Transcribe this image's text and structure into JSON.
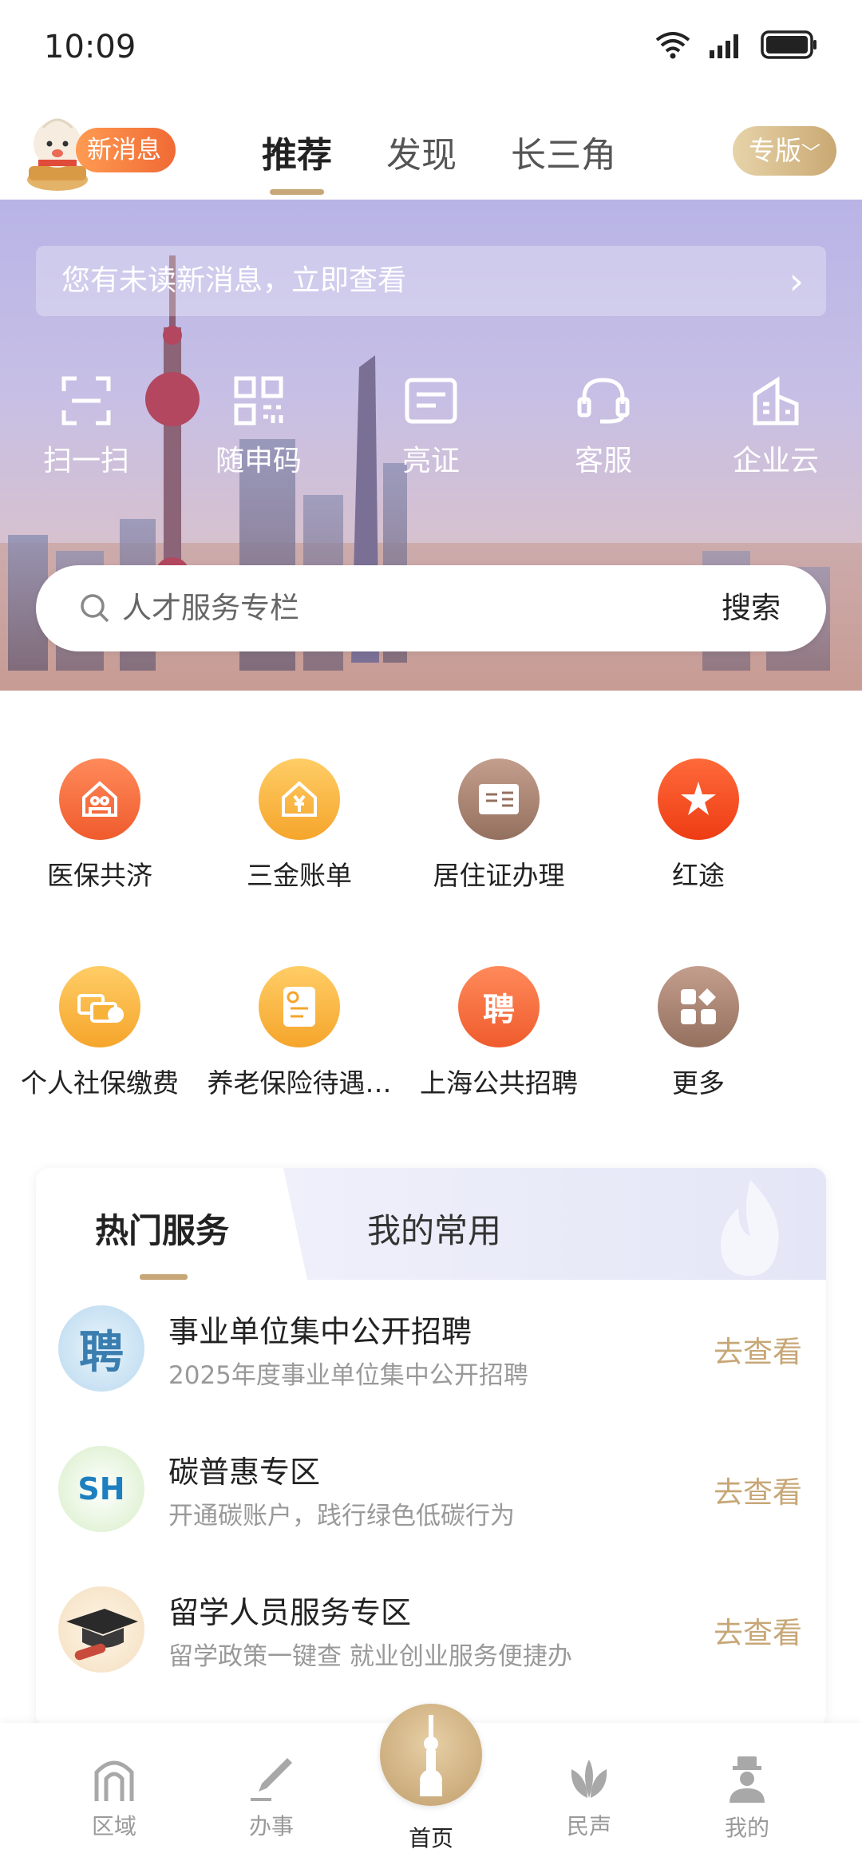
{
  "status": {
    "time": "10:09",
    "icons": [
      "wifi-icon",
      "signal-icon",
      "battery-icon"
    ]
  },
  "topnav": {
    "new_message": "新消息",
    "tabs": [
      {
        "label": "推荐",
        "active": true
      },
      {
        "label": "发现"
      },
      {
        "label": "长三角"
      }
    ],
    "edition": "专版"
  },
  "hero": {
    "unread_text": "您有未读新消息，立即查看",
    "quick_actions": [
      {
        "label": "扫一扫",
        "icon": "scan-icon"
      },
      {
        "label": "随申码",
        "icon": "qr-code-icon"
      },
      {
        "label": "亮证",
        "icon": "id-card-icon"
      },
      {
        "label": "客服",
        "icon": "headset-icon"
      },
      {
        "label": "企业云",
        "icon": "building-icon"
      }
    ],
    "search_placeholder": "人才服务专栏",
    "search_button": "搜索"
  },
  "services_grid": [
    {
      "label": "医保共济",
      "icon": "family-house-icon",
      "color": "#f36a3a"
    },
    {
      "label": "三金账单",
      "icon": "yuan-house-icon",
      "color": "#f7b23a"
    },
    {
      "label": "居住证办理",
      "icon": "residence-card-icon",
      "color": "#a98273"
    },
    {
      "label": "红途",
      "icon": "star-flag-icon",
      "color": "#f24d1f"
    },
    {
      "label": "个人社保缴费",
      "icon": "social-security-icon",
      "color": "#f7b23a"
    },
    {
      "label": "养老保险待遇…",
      "icon": "pension-doc-icon",
      "color": "#f7b23a"
    },
    {
      "label": "上海公共招聘",
      "icon": "recruit-icon",
      "glyph": "聘",
      "color": "#f36a3a"
    },
    {
      "label": "更多",
      "icon": "more-grid-icon",
      "color": "#a98273"
    }
  ],
  "hot": {
    "tab_hot": "热门服务",
    "tab_mine": "我的常用",
    "items": [
      {
        "title": "事业单位集中公开招聘",
        "subtitle": "2025年度事业单位集中公开招聘",
        "action": "去查看",
        "logo_glyph": "聘"
      },
      {
        "title": "碳普惠专区",
        "subtitle": "开通碳账户，践行绿色低碳行为",
        "action": "去查看",
        "logo_glyph": "SH"
      },
      {
        "title": "留学人员服务专区",
        "subtitle": "留学政策一键查 就业创业服务便捷办",
        "action": "去查看",
        "logo_glyph": "graduation-cap-icon"
      }
    ]
  },
  "tabbar": {
    "items": [
      {
        "label": "区域",
        "icon": "arch-icon"
      },
      {
        "label": "办事",
        "icon": "pen-icon"
      },
      {
        "label": "首页",
        "icon": "tower-icon",
        "active": true
      },
      {
        "label": "民声",
        "icon": "lotus-icon"
      },
      {
        "label": "我的",
        "icon": "person-icon"
      }
    ]
  }
}
